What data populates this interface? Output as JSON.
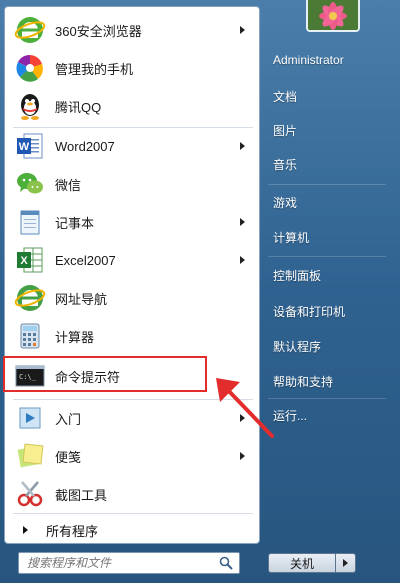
{
  "left_items": [
    {
      "label": "360安全浏览器",
      "icon": "ie-360-browser-icon",
      "arrow": true
    },
    {
      "label": "管理我的手机",
      "icon": "phone-manager-icon",
      "arrow": false
    },
    {
      "label": "腾讯QQ",
      "icon": "qq-penguin-icon",
      "arrow": false
    },
    {
      "label": "Word2007",
      "icon": "word-icon",
      "arrow": true
    },
    {
      "label": "微信",
      "icon": "wechat-icon",
      "arrow": false
    },
    {
      "label": "记事本",
      "icon": "notepad-icon",
      "arrow": true
    },
    {
      "label": "Excel2007",
      "icon": "excel-icon",
      "arrow": true
    },
    {
      "label": "网址导航",
      "icon": "ie-navigation-icon",
      "arrow": false
    },
    {
      "label": "计算器",
      "icon": "calculator-icon",
      "arrow": false
    },
    {
      "label": "命令提示符",
      "icon": "cmd-icon",
      "arrow": false
    },
    {
      "label": "入门",
      "icon": "getting-started-icon",
      "arrow": true
    },
    {
      "label": "便笺",
      "icon": "sticky-notes-icon",
      "arrow": true
    },
    {
      "label": "截图工具",
      "icon": "snipping-tool-icon",
      "arrow": false
    }
  ],
  "all_programs": {
    "label": "所有程序"
  },
  "search": {
    "placeholder": "搜索程序和文件"
  },
  "right_items": [
    {
      "label": "Administrator"
    },
    {
      "label": "文档"
    },
    {
      "label": "图片"
    },
    {
      "label": "音乐"
    },
    {
      "label": "游戏"
    },
    {
      "label": "计算机"
    },
    {
      "label": "控制面板"
    },
    {
      "label": "设备和打印机"
    },
    {
      "label": "默认程序"
    },
    {
      "label": "帮助和支持"
    },
    {
      "label": "运行..."
    }
  ],
  "shutdown": {
    "label": "关机"
  },
  "colors": {
    "highlight": "#e32c2c",
    "menu_blue": "#2f6290"
  }
}
